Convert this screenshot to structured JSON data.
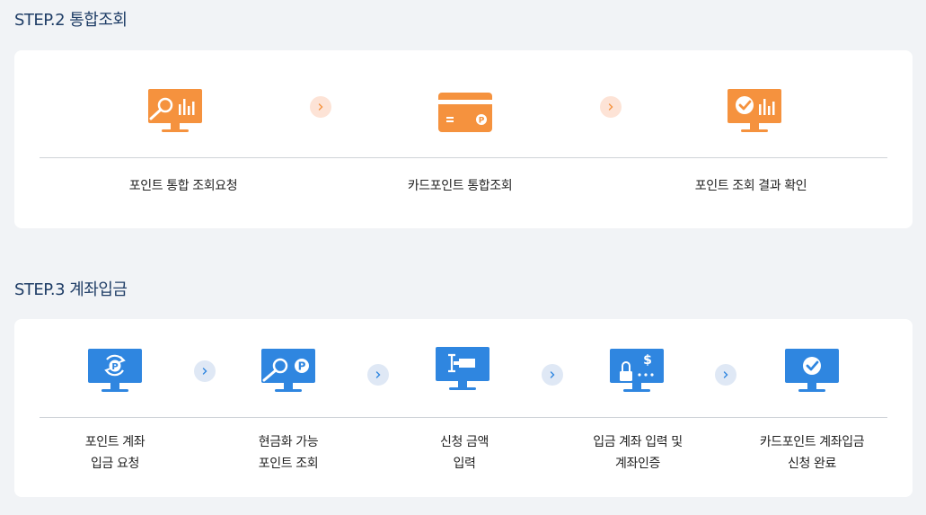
{
  "step2": {
    "title": "STEP.2 통합조회",
    "steps": [
      {
        "icon": "monitor-search-chart-icon",
        "label": "포인트 통합 조회요청"
      },
      {
        "icon": "point-card-icon",
        "label": "카드포인트 통합조회"
      },
      {
        "icon": "monitor-check-chart-icon",
        "label": "포인트 조회 결과 확인"
      }
    ]
  },
  "step3": {
    "title": "STEP.3 계좌입금",
    "steps": [
      {
        "icon": "monitor-point-refresh-icon",
        "line1": "포인트 계좌",
        "line2": "입금 요청"
      },
      {
        "icon": "monitor-point-search-icon",
        "line1": "현금화 가능",
        "line2": "포인트 조회"
      },
      {
        "icon": "monitor-amount-input-icon",
        "line1": "신청 금액",
        "line2": "입력"
      },
      {
        "icon": "monitor-lock-dollar-icon",
        "line1": "입금 계좌 입력 및",
        "line2": "계좌인증"
      },
      {
        "icon": "monitor-check-icon",
        "line1": "카드포인트 계좌입금",
        "line2": "신청 완료"
      }
    ]
  },
  "colors": {
    "orange": "#f5923e",
    "blue": "#2f86e0",
    "title": "#1f3d66"
  }
}
